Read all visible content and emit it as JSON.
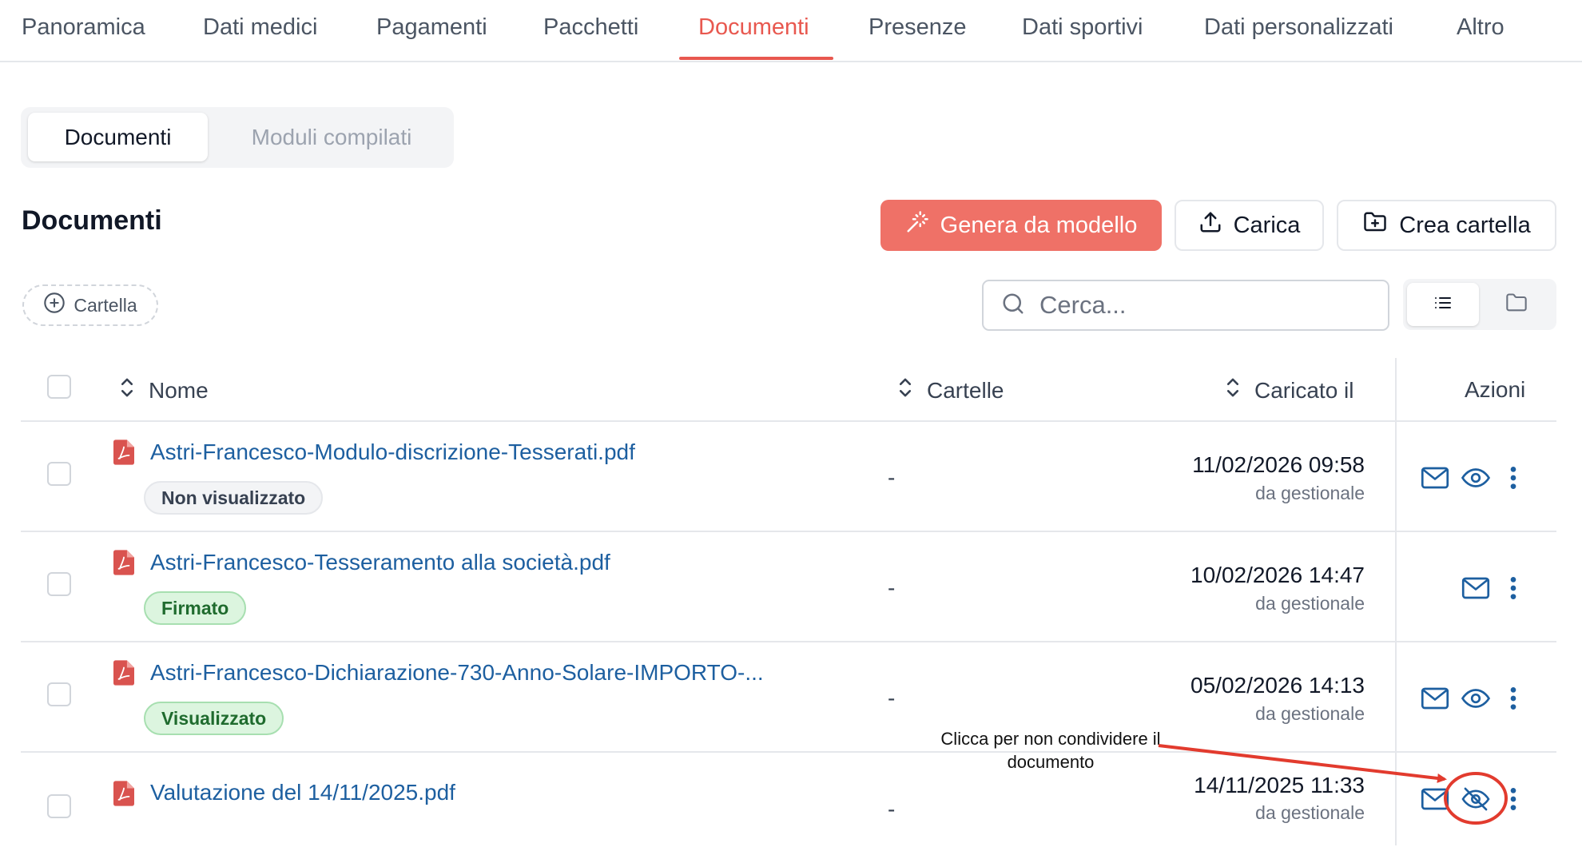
{
  "top_tabs": [
    {
      "label": "Panoramica",
      "active": false
    },
    {
      "label": "Dati medici",
      "active": false
    },
    {
      "label": "Pagamenti",
      "active": false
    },
    {
      "label": "Pacchetti",
      "active": false
    },
    {
      "label": "Documenti",
      "active": true
    },
    {
      "label": "Presenze",
      "active": false
    },
    {
      "label": "Dati sportivi",
      "active": false
    },
    {
      "label": "Dati personalizzati",
      "active": false
    },
    {
      "label": "Altro",
      "active": false
    }
  ],
  "segments": {
    "documents": "Documenti",
    "compiled_forms": "Moduli compilati",
    "selected": "Documenti"
  },
  "section": {
    "title": "Documenti"
  },
  "buttons": {
    "generate": "Genera da modello",
    "upload": "Carica",
    "create_folder": "Crea cartella"
  },
  "folder_chip": {
    "label": "Cartella"
  },
  "search": {
    "placeholder": "Cerca..."
  },
  "view_toggle": {
    "selected": "list",
    "options": [
      "list-icon",
      "folder-icon"
    ]
  },
  "table": {
    "headers": {
      "name": "Nome",
      "folders": "Cartelle",
      "uploaded": "Caricato il",
      "actions": "Azioni"
    },
    "rows": [
      {
        "name": "Astri-Francesco-Modulo-discrizione-Tesserati.pdf",
        "status": "Non visualizzato",
        "status_style": "gray",
        "folder": "-",
        "date": "11/02/2026 09:58",
        "source": "da gestionale",
        "actions": [
          "mail-icon",
          "eye-icon",
          "more-vertical-icon"
        ]
      },
      {
        "name": "Astri-Francesco-Tesseramento alla società.pdf",
        "status": "Firmato",
        "status_style": "green",
        "folder": "-",
        "date": "10/02/2026 14:47",
        "source": "da gestionale",
        "actions": [
          "mail-icon",
          "more-vertical-icon"
        ]
      },
      {
        "name": "Astri-Francesco-Dichiarazione-730-Anno-Solare-IMPORTO-...",
        "status": "Visualizzato",
        "status_style": "green",
        "folder": "-",
        "date": "05/02/2026 14:13",
        "source": "da gestionale",
        "actions": [
          "mail-icon",
          "eye-icon",
          "more-vertical-icon"
        ]
      },
      {
        "name": "Valutazione del 14/11/2025.pdf",
        "status": "",
        "status_style": "",
        "folder": "-",
        "date": "14/11/2025 11:33",
        "source": "da gestionale",
        "actions": [
          "mail-icon",
          "eye-off-icon",
          "more-vertical-icon"
        ]
      }
    ]
  },
  "annotation": {
    "text": "Clicca per non condividere il documento",
    "color": "#e23b2e"
  },
  "colors": {
    "accent": "#e8584f",
    "primary_button": "#ef7167",
    "link": "#1d5fa0",
    "badge_green_bg": "#dcf5df",
    "badge_green_text": "#1f6b2e",
    "badge_gray_bg": "#f3f4f6"
  }
}
